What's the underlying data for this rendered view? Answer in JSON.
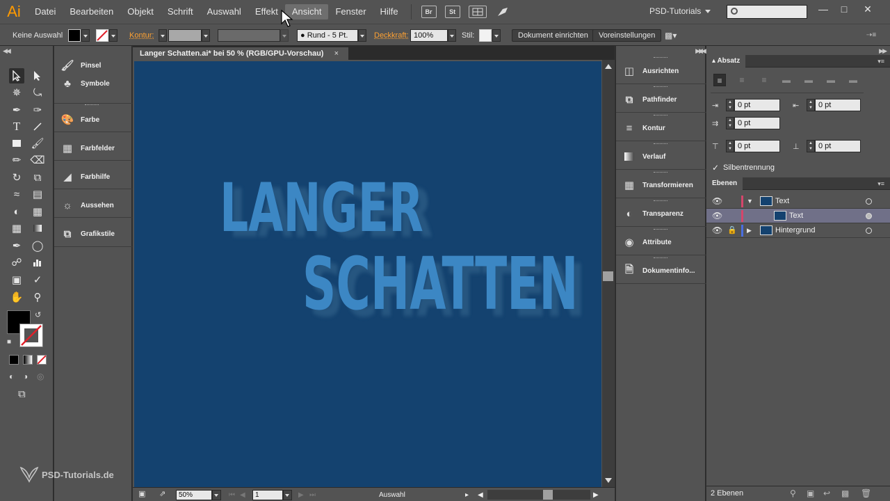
{
  "app": {
    "logo": "Ai",
    "menu": [
      "Datei",
      "Bearbeiten",
      "Objekt",
      "Schrift",
      "Auswahl",
      "Effekt",
      "Ansicht",
      "Fenster",
      "Hilfe"
    ],
    "active_menu": "Ansicht",
    "bridge_icon": "Br",
    "stock_icon": "St",
    "workspace": "PSD-Tutorials",
    "window_controls": [
      "minimize-icon",
      "maximize-icon",
      "close-icon"
    ]
  },
  "control_bar": {
    "selection_label": "Keine Auswahl",
    "stroke_label": "Kontur:",
    "brush_label": "Rund - 5 Pt.",
    "opacity_label": "Deckkraft:",
    "opacity_value": "100%",
    "style_label": "Stil:",
    "doc_setup_button": "Dokument einrichten",
    "preferences_button": "Voreinstellungen"
  },
  "left_dock": [
    {
      "label": "Pinsel",
      "icon": "brush-icon"
    },
    {
      "label": "Symbole",
      "icon": "symbols-icon"
    },
    {
      "label": "Farbe",
      "icon": "palette-icon"
    },
    {
      "label": "Farbfelder",
      "icon": "swatches-icon"
    },
    {
      "label": "Farbhilfe",
      "icon": "color-guide-icon"
    },
    {
      "label": "Aussehen",
      "icon": "appearance-icon"
    },
    {
      "label": "Grafikstile",
      "icon": "graphic-styles-icon"
    }
  ],
  "document": {
    "tab_title": "Langer Schatten.ai* bei 50 % (RGB/GPU-Vorschau)",
    "artboard_color": "#14426f",
    "text_color": "#3c87c4",
    "shadow_color": "#2e5f87",
    "line1": "LANGER",
    "line2": "SCHATTEN"
  },
  "status_bar": {
    "zoom": "50%",
    "artboard_number": "1",
    "status_text": "Auswahl"
  },
  "middle_dock": [
    {
      "label": "Ausrichten",
      "icon": "align-icon"
    },
    {
      "label": "Pathfinder",
      "icon": "pathfinder-icon"
    },
    {
      "label": "Kontur",
      "icon": "stroke-icon"
    },
    {
      "label": "Verlauf",
      "icon": "gradient-icon"
    },
    {
      "label": "Transformieren",
      "icon": "transform-icon"
    },
    {
      "label": "Transparenz",
      "icon": "transparency-icon"
    },
    {
      "label": "Attribute",
      "icon": "attributes-icon"
    },
    {
      "label": "Dokumentinfo...",
      "icon": "document-info-icon"
    }
  ],
  "paragraph_panel": {
    "title": "Absatz",
    "left_indent": "0 pt",
    "right_indent": "0 pt",
    "first_line_indent": "0 pt",
    "space_before": "0 pt",
    "space_after": "0 pt",
    "hyphenation_label": "Silbentrennung",
    "hyphenation_checked": true
  },
  "layers_panel": {
    "title": "Ebenen",
    "layers": [
      {
        "name": "Text",
        "color": "#d5466b",
        "expanded": true,
        "locked": false
      },
      {
        "name": "Text",
        "color": "#d5466b",
        "sublayer": true,
        "selected": true
      },
      {
        "name": "Hintergrund",
        "color": "#4a6ee0",
        "expanded": false,
        "locked": true
      }
    ],
    "count_label": "2 Ebenen"
  },
  "watermark": "PSD-Tutorials.de"
}
